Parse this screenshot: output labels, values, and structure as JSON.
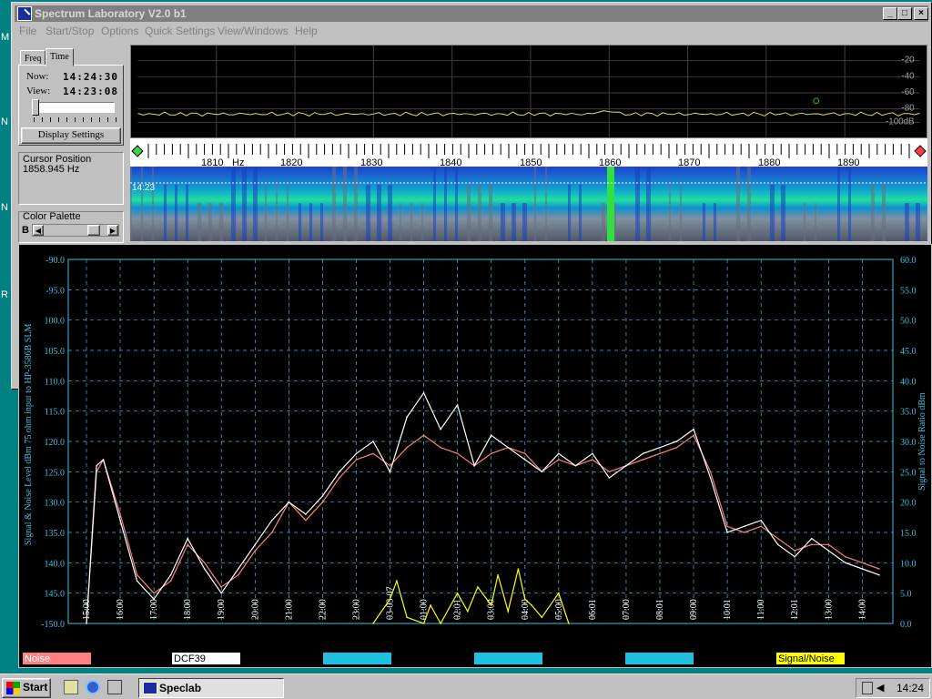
{
  "window": {
    "title": "Spectrum Laboratory V2.0 b1",
    "min_label": "_",
    "max_label": "□",
    "close_label": "×"
  },
  "menu": [
    "File",
    "Start/Stop",
    "Options",
    "Quick Settings",
    "View/Windows",
    "Help"
  ],
  "desktop_letters": [
    "M",
    "N",
    "N",
    "R"
  ],
  "left_panel": {
    "tabs": [
      "Freq",
      "Time"
    ],
    "now_label": "Now:",
    "now_value": "14:24:30",
    "view_label": "View:",
    "view_value": "14:23:08",
    "display_settings_label": "Display Settings",
    "cursor_position_label": "Cursor Position",
    "cursor_position_value": "1858.945 Hz",
    "color_palette_label": "Color Palette",
    "palette_b_label": "B"
  },
  "spectrum": {
    "db_labels": [
      "-20",
      "-40",
      "-60",
      "-80",
      "-100dB"
    ],
    "freq_labels": [
      "1810",
      "Hz",
      "1820",
      "1830",
      "1840",
      "1850",
      "1860",
      "1870",
      "1880",
      "1890"
    ],
    "waterfall_time": "14:23"
  },
  "chart_data": {
    "type": "line",
    "left_axis": {
      "label": "Signal & Noise Level dBm 75 ohm input to HP-3586B SLM",
      "min": -150,
      "max": -90,
      "ticks": [
        "-90.0",
        "-95.0",
        "100.0",
        "105.0",
        "110.0",
        "115.0",
        "120.0",
        "125.0",
        "130.0",
        "135.0",
        "140.0",
        "145.0",
        "-150.0"
      ]
    },
    "right_axis": {
      "label": "Signal to Noise Ratio  dBm",
      "min": 0,
      "max": 60,
      "ticks": [
        "60.0",
        "55.0",
        "50.0",
        "45.0",
        "40.0",
        "35.0",
        "30.0",
        "25.0",
        "20.0",
        "15.0",
        "10.0",
        "5.0",
        "0.0"
      ]
    },
    "x_labels": [
      "15:00",
      "16:00",
      "17:00",
      "18:00",
      "19:00",
      "20:00",
      "21:00",
      "22:00",
      "23:00",
      "03-03-07",
      "01:00",
      "02:01",
      "03:00",
      "04:00",
      "05:00",
      "06:01",
      "07:00",
      "08:01",
      "09:00",
      "10:01",
      "11:00",
      "12:01",
      "13:00",
      "14:00"
    ],
    "series": [
      {
        "name": "Noise",
        "color": "#ff8080",
        "x": [
          0,
          0.3,
          0.5,
          1,
          1.5,
          2,
          2.5,
          3,
          3.5,
          4,
          4.5,
          5,
          5.5,
          6,
          6.5,
          7,
          7.5,
          8,
          8.5,
          9,
          9.5,
          10,
          10.5,
          11,
          11.5,
          12,
          12.5,
          13,
          13.5,
          14,
          14.5,
          15,
          15.5,
          16,
          16.5,
          17,
          17.5,
          18,
          18.5,
          19,
          19.5,
          20,
          20.5,
          21,
          21.5,
          22,
          22.5,
          23,
          23.5
        ],
        "values": [
          -150,
          -125,
          -123,
          -132,
          -142,
          -145,
          -143,
          -137,
          -140,
          -144,
          -142,
          -138,
          -135,
          -130,
          -133,
          -130,
          -126,
          -123,
          -122,
          -124,
          -121,
          -119,
          -121,
          -122,
          -124,
          -122,
          -121,
          -122,
          -125,
          -123,
          -124,
          -123,
          -125,
          -124,
          -123,
          -122,
          -121,
          -119,
          -125,
          -134,
          -135,
          -134,
          -136,
          -138,
          -137,
          -137,
          -139,
          -140,
          -141
        ]
      },
      {
        "name": "DCF39",
        "color": "#ffffff",
        "x": [
          0,
          0.3,
          0.5,
          1,
          1.5,
          2,
          2.5,
          3,
          3.5,
          4,
          4.5,
          5,
          5.5,
          6,
          6.5,
          7,
          7.5,
          8,
          8.5,
          9,
          9.5,
          10,
          10.5,
          11,
          11.5,
          12,
          12.5,
          13,
          13.5,
          14,
          14.5,
          15,
          15.5,
          16,
          16.5,
          17,
          17.5,
          18,
          18.5,
          19,
          19.5,
          20,
          20.5,
          21,
          21.5,
          22,
          22.5,
          23,
          23.5
        ],
        "values": [
          -150,
          -124,
          -123,
          -133,
          -143,
          -146,
          -142,
          -136,
          -141,
          -145,
          -141,
          -137,
          -133,
          -130,
          -132,
          -129,
          -125,
          -122,
          -120,
          -125,
          -116,
          -112,
          -118,
          -114,
          -124,
          -119,
          -121,
          -123,
          -125,
          -122,
          -124,
          -122,
          -126,
          -124,
          -122,
          -121,
          -120,
          -118,
          -126,
          -135,
          -134,
          -133,
          -137,
          -139,
          -136,
          -138,
          -140,
          -141,
          -142
        ]
      },
      {
        "name": "Signal/Noise",
        "color": "#ffff00",
        "x": [
          8.5,
          9,
          9.2,
          9.5,
          10,
          10.2,
          10.5,
          11,
          11.3,
          11.6,
          12,
          12.2,
          12.5,
          12.8,
          13,
          13.2,
          13.5,
          14,
          14.3
        ],
        "values": [
          0,
          4,
          7,
          1,
          0,
          3,
          0,
          5,
          2,
          6,
          3,
          8,
          2,
          9,
          4,
          3,
          1,
          5,
          0
        ]
      }
    ],
    "legend": [
      "Noise",
      "DCF39",
      "",
      "",
      "",
      "Signal/Noise"
    ],
    "grid": true
  },
  "taskbar": {
    "start_label": "Start",
    "task_label": "Speclab",
    "clock": "14:24"
  }
}
